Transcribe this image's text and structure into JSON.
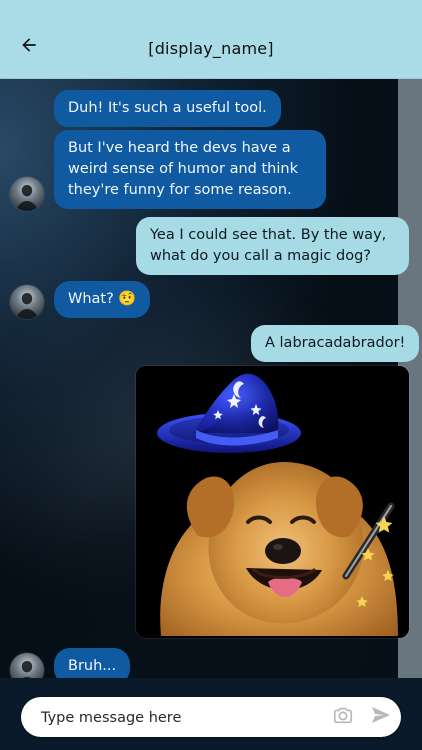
{
  "header": {
    "title": "[display_name]"
  },
  "messages": [
    {
      "type": "incoming",
      "text": "Duh! It's such a useful tool."
    },
    {
      "type": "incoming",
      "text": "But I've heard the devs have a weird sense of humor and think they're funny for some reason."
    },
    {
      "type": "outgoing",
      "text": "Yea I could see that. By the way, what do you call a magic dog?"
    },
    {
      "type": "incoming",
      "text": "What? 🤨"
    },
    {
      "type": "outgoing",
      "text": "A labracadabrador!"
    },
    {
      "type": "image",
      "icon": "wizard-dog-image"
    },
    {
      "type": "incoming",
      "text": "Bruh..."
    }
  ],
  "composer": {
    "placeholder": "Type message here"
  },
  "icons": {
    "back": "arrow-left-icon",
    "camera": "camera-icon",
    "send": "send-icon",
    "avatar": "user-avatar"
  },
  "colors": {
    "header_bg": "#a9dce6",
    "incoming_bubble": "#0f5aa1",
    "outgoing_bubble": "#a6dbe5",
    "icon_gray": "#b8b8b8"
  }
}
